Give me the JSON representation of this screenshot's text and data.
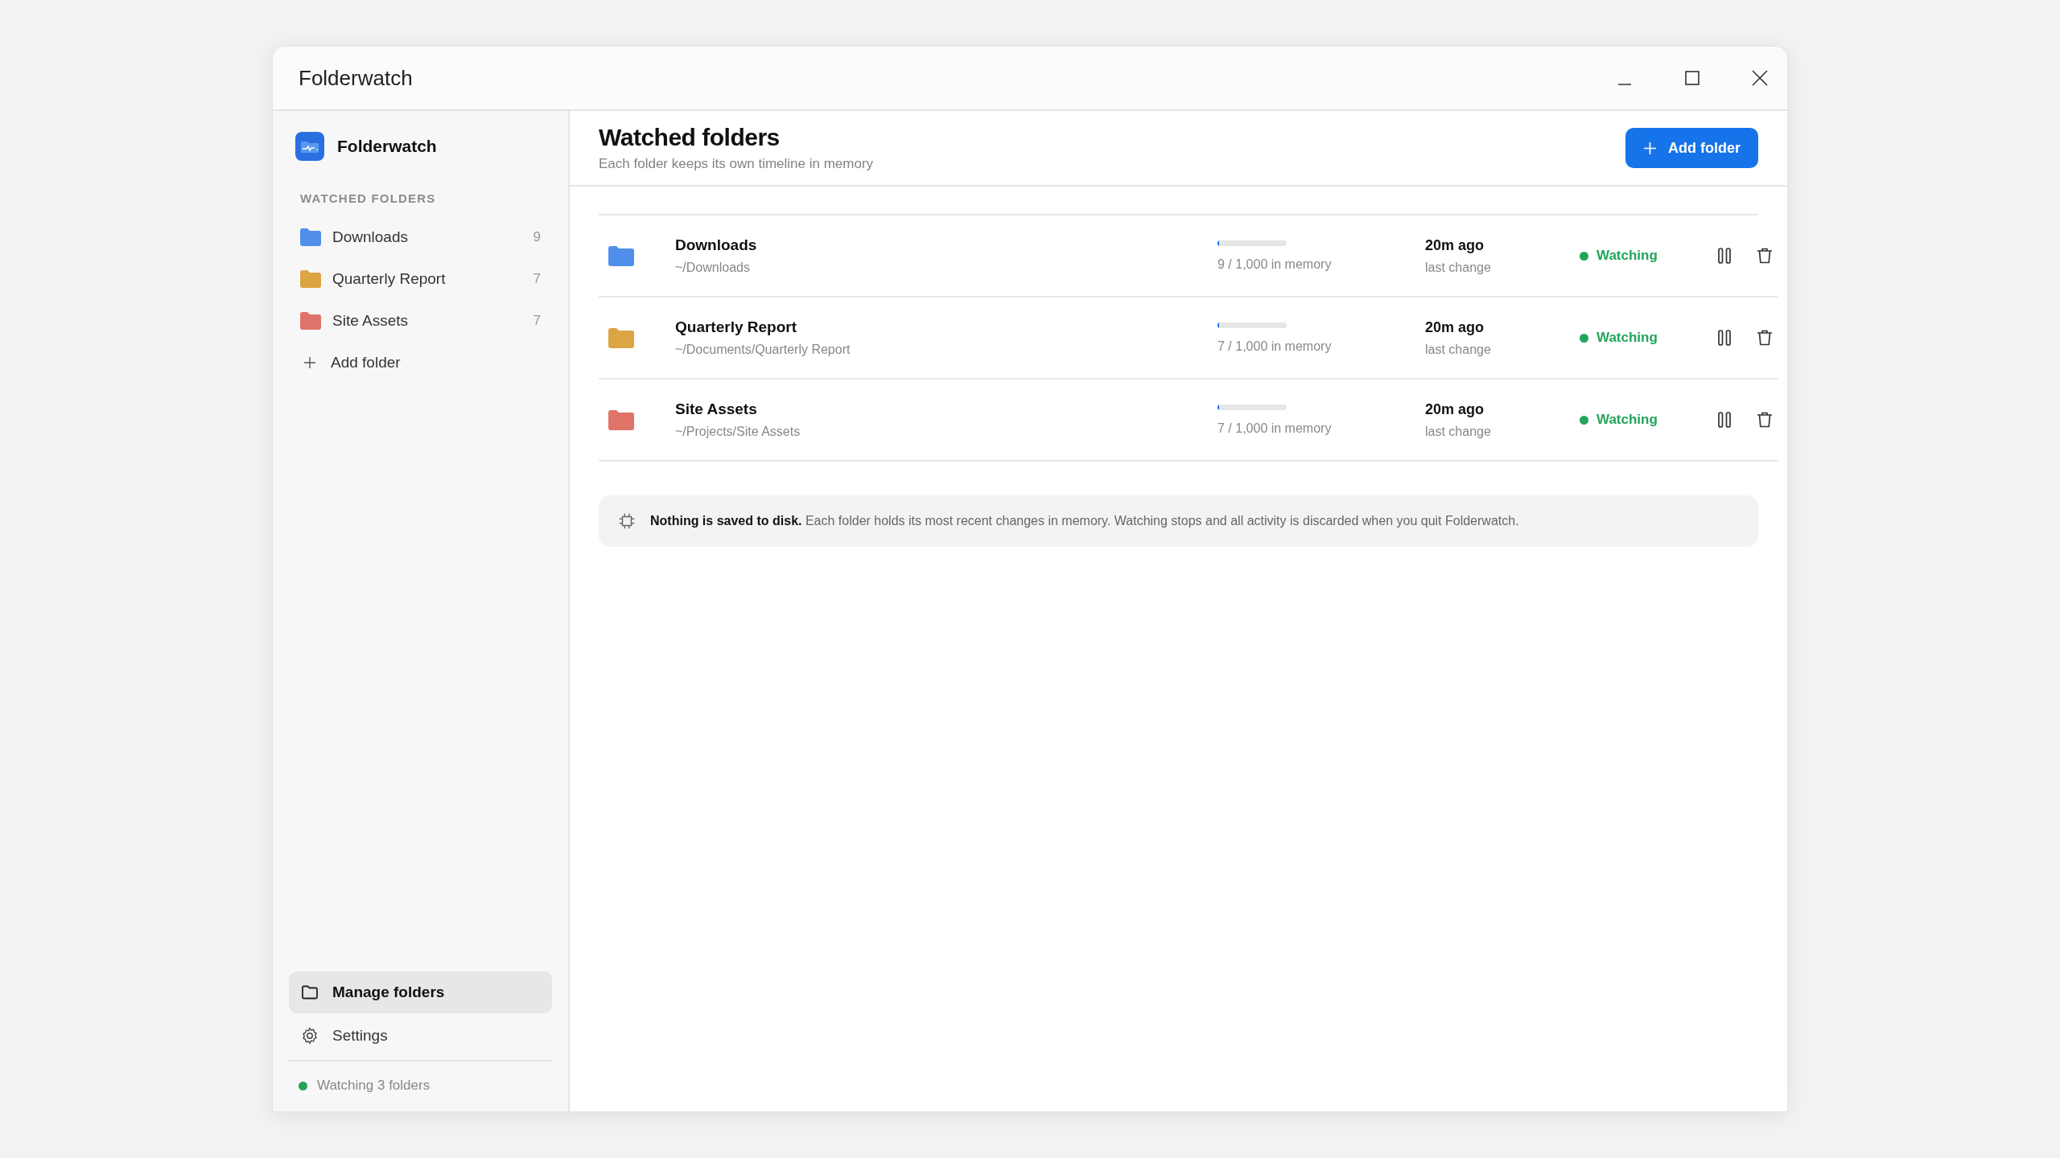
{
  "window": {
    "title": "Folderwatch"
  },
  "sidebar": {
    "app_name": "Folderwatch",
    "section_title": "WATCHED FOLDERS",
    "folders": [
      {
        "name": "Downloads",
        "count": "9",
        "color": "#4f8fea"
      },
      {
        "name": "Quarterly Report",
        "count": "7",
        "color": "#dca443"
      },
      {
        "name": "Site Assets",
        "count": "7",
        "color": "#e0736a"
      }
    ],
    "add_folder": "Add folder",
    "nav": [
      {
        "kind": "folder",
        "label": "Manage folders",
        "selected": true
      },
      {
        "kind": "settings",
        "label": "Settings",
        "selected": false
      }
    ],
    "status": "Watching 3 folders"
  },
  "header": {
    "title": "Watched folders",
    "subtitle": "Each folder keeps its own timeline in memory",
    "button": "Add folder"
  },
  "rows": [
    {
      "name": "Downloads",
      "path": "~/Downloads",
      "color": "#4f8fea",
      "level": 0.009,
      "memory": "9 / 1,000 in memory",
      "time": "20m ago",
      "time_label": "last change",
      "status": "Watching"
    },
    {
      "name": "Quarterly Report",
      "path": "~/Documents/Quarterly Report",
      "color": "#dca443",
      "level": 0.007,
      "memory": "7 / 1,000 in memory",
      "time": "20m ago",
      "time_label": "last change",
      "status": "Watching"
    },
    {
      "name": "Site Assets",
      "path": "~/Projects/Site Assets",
      "color": "#e0736a",
      "level": 0.007,
      "memory": "7 / 1,000 in memory",
      "time": "20m ago",
      "time_label": "last change",
      "status": "Watching"
    }
  ],
  "note": "**Nothing is saved to disk.** Each folder holds its most recent changes in memory. Watching stops and all activity is discarded when you quit Folderwatch."
}
